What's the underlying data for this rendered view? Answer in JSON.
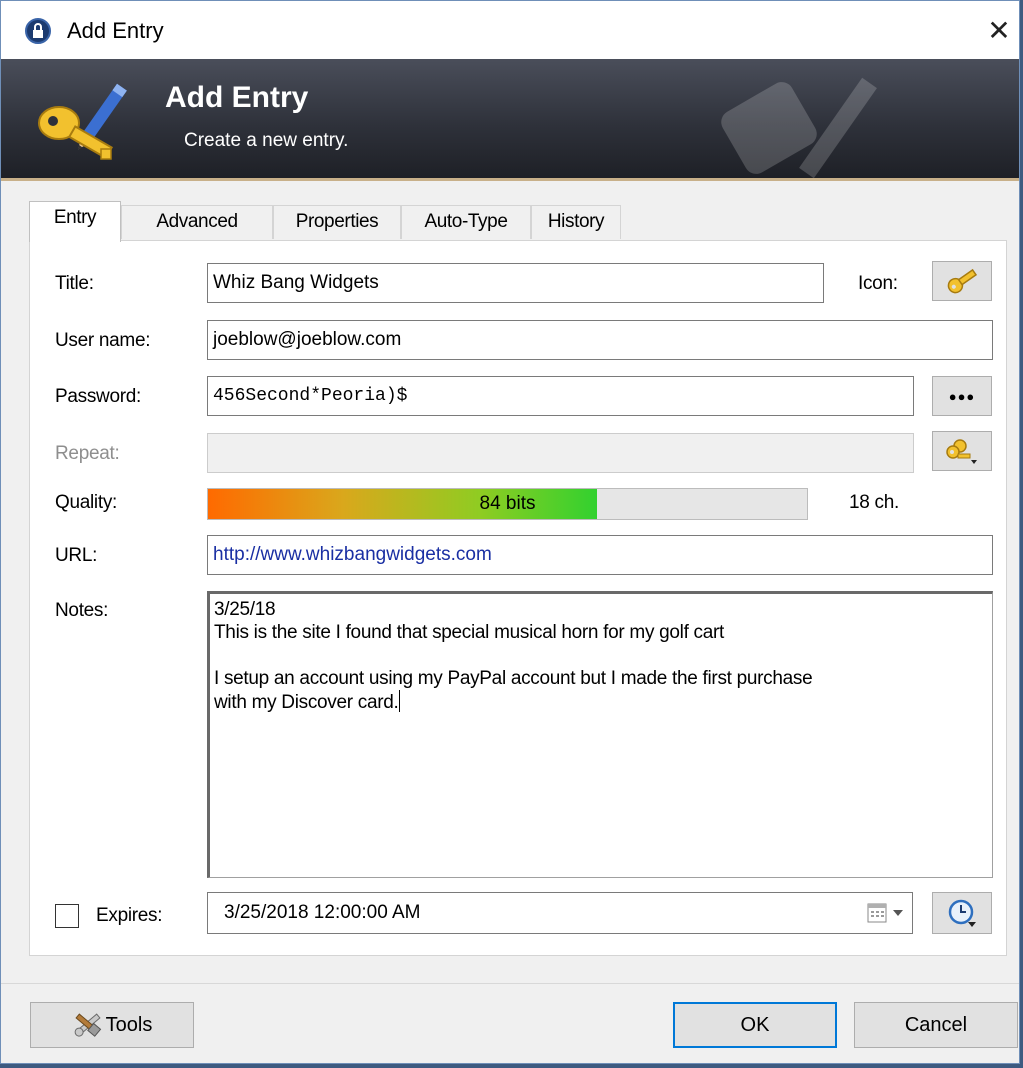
{
  "window": {
    "title": "Add Entry",
    "close_glyph": "✕"
  },
  "banner": {
    "title": "Add Entry",
    "subtitle": "Create a new entry."
  },
  "tabs": [
    {
      "label": "Entry",
      "active": true
    },
    {
      "label": "Advanced",
      "active": false
    },
    {
      "label": "Properties",
      "active": false
    },
    {
      "label": "Auto-Type",
      "active": false
    },
    {
      "label": "History",
      "active": false
    }
  ],
  "form": {
    "title_label": "Title:",
    "title_value": "Whiz Bang Widgets",
    "icon_label": "Icon:",
    "username_label": "User name:",
    "username_value": "joeblow@joeblow.com",
    "password_label": "Password:",
    "password_value": "456Second*Peoria)$",
    "repeat_label": "Repeat:",
    "repeat_value": "",
    "quality_label": "Quality:",
    "quality_text": "84 bits",
    "quality_fraction": 0.65,
    "length_text": "18 ch.",
    "url_label": "URL:",
    "url_value": "http://www.whizbangwidgets.com",
    "notes_label": "Notes:",
    "notes_value": "3/25/18\nThis is the site I found that special musical horn for my golf cart\n\nI setup an account using my PayPal account but I made the first purchase\nwith my Discover card.",
    "expires_label": "Expires:",
    "expires_checked": false,
    "expires_value": "3/25/2018 12:00:00 AM",
    "show_password_glyph": "●●●"
  },
  "buttons": {
    "tools": "Tools",
    "ok": "OK",
    "cancel": "Cancel"
  },
  "colors": {
    "banner_dark": "#1d1f25",
    "link": "#1a2fa3",
    "default_button_border": "#0078d7"
  },
  "icons": [
    "lock-icon",
    "close-icon",
    "key-pencil-icon",
    "key-icon",
    "show-password-icon",
    "generate-password-icon",
    "calendar-icon",
    "clock-icon",
    "tools-icon"
  ]
}
